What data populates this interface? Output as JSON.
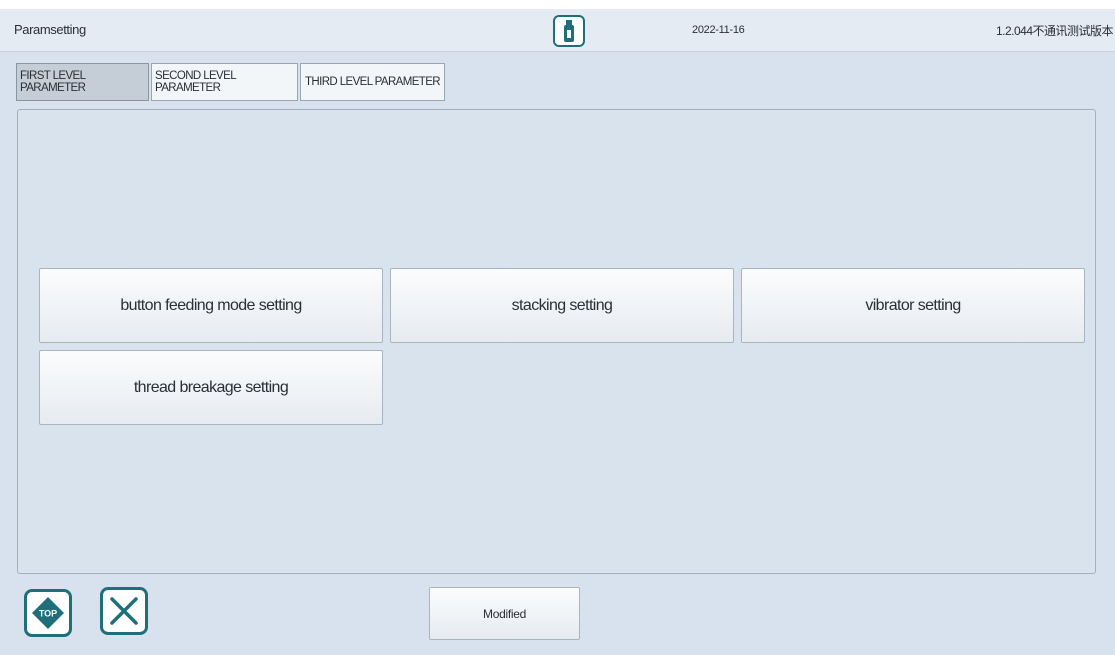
{
  "header": {
    "title": "Paramsetting",
    "date": "2022-11-16",
    "version": "1.2.044不通讯测试版本",
    "usb_icon": "usb-drive-icon"
  },
  "tabs": [
    {
      "label": "FIRST LEVEL PARAMETER",
      "active": true
    },
    {
      "label": "SECOND LEVEL PARAMETER",
      "active": false
    },
    {
      "label": "THIRD LEVEL PARAMETER",
      "active": false
    }
  ],
  "settings": [
    {
      "label": "button feeding mode setting"
    },
    {
      "label": "stacking setting"
    },
    {
      "label": "vibrator setting"
    },
    {
      "label": "thread breakage setting"
    }
  ],
  "footer": {
    "top_icon_text": "TOP",
    "modified_label": "Modified"
  },
  "colors": {
    "accent": "#1f6f7a",
    "background": "#d7e2ee",
    "active_tab": "#c5cdd6"
  }
}
